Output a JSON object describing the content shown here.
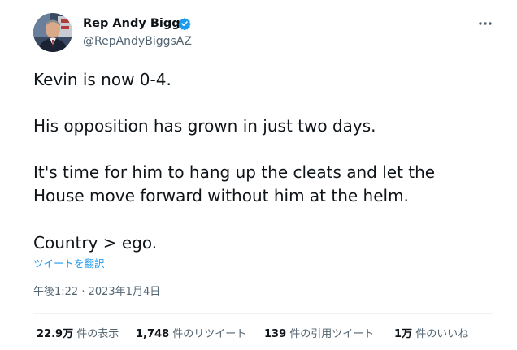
{
  "author": {
    "display_name": "Rep Andy Biggs",
    "handle": "@RepAndyBiggsAZ",
    "verified": true,
    "verified_icon": "verified-badge-icon",
    "verified_color": "#1d9bf0"
  },
  "menu": {
    "icon": "more-horizontal-icon"
  },
  "tweet": {
    "lines": [
      "Kevin is now 0-4.",
      "His opposition has grown in just two days.",
      "It's time for him to hang up the cleats and let the",
      "House move forward without him at the helm.",
      "Country > ego."
    ],
    "translate_label": "ツイートを翻訳",
    "timestamp": "午後1:22 · 2023年1月4日"
  },
  "stats": [
    {
      "count": "22.9万",
      "label": "件の表示"
    },
    {
      "count": "1,748",
      "label": "件のリツイート"
    },
    {
      "count": "139",
      "label": "件の引用ツイート"
    },
    {
      "count": "1万",
      "label": "件のいいね"
    }
  ],
  "colors": {
    "text_primary": "#0f1419",
    "text_secondary": "#536471",
    "link": "#1d9bf0",
    "divider": "#eff3f4"
  }
}
